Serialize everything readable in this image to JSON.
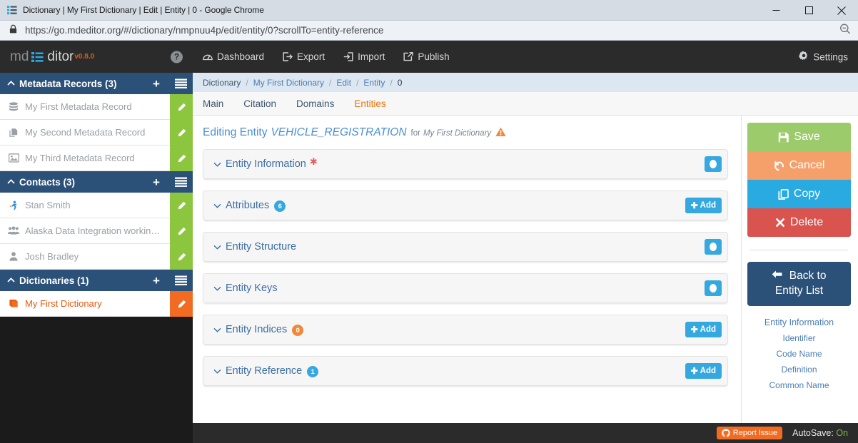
{
  "browser": {
    "tab_title": "Dictionary | My First Dictionary | Edit | Entity | 0 - Google Chrome",
    "favicon_name": "mdeditor-list-icon",
    "url": "https://go.mdeditor.org/#/dictionary/nmpnuu4p/edit/entity/0?scrollTo=entity-reference",
    "url_scheme": "https://",
    "url_domain": "go.mdeditor.org",
    "url_path": "/#/dictionary/nmpnuu4p/edit/entity/0?scrollTo=entity-reference",
    "lock_icon": "lock-icon",
    "zoom_icon": "zoom-out-icon",
    "minimize_label": "Minimize",
    "maximize_label": "Maximize",
    "close_label": "Close"
  },
  "brand": {
    "prefix": "md",
    "suffix": "ditor",
    "version": "v0.8.0",
    "help_label": "?",
    "logo_icon": "list-blue-icon"
  },
  "sidebar": {
    "groups": [
      {
        "title": "Metadata Records (3)",
        "caret": "⌃",
        "add_label": "+",
        "menu_icon": "list-menu-icon",
        "items": [
          {
            "label": "My First Metadata Record",
            "icon": "database-icon",
            "active": false
          },
          {
            "label": "My Second Metadata Record",
            "icon": "copy-files-icon",
            "active": false
          },
          {
            "label": "My Third Metadata Record",
            "icon": "image-icon",
            "active": false
          }
        ]
      },
      {
        "title": "Contacts (3)",
        "caret": "⌃",
        "add_label": "+",
        "menu_icon": "list-menu-icon",
        "items": [
          {
            "label": "Stan Smith",
            "icon": "runner-person-icon",
            "active": false
          },
          {
            "label": "Alaska Data Integration working…",
            "icon": "group-people-icon",
            "active": false
          },
          {
            "label": "Josh Bradley",
            "icon": "person-icon",
            "active": false
          }
        ]
      },
      {
        "title": "Dictionaries (1)",
        "caret": "⌃",
        "add_label": "+",
        "menu_icon": "list-menu-icon",
        "items": [
          {
            "label": "My First Dictionary",
            "icon": "book-icon",
            "active": true
          }
        ]
      }
    ]
  },
  "topnav": {
    "items": [
      {
        "label": "Dashboard",
        "icon": "dashboard-icon"
      },
      {
        "label": "Export",
        "icon": "export-icon"
      },
      {
        "label": "Import",
        "icon": "import-icon"
      },
      {
        "label": "Publish",
        "icon": "publish-icon"
      }
    ],
    "settings_label": "Settings",
    "settings_icon": "gear-icon"
  },
  "breadcrumb": {
    "items": [
      "Dictionary",
      "My First Dictionary",
      "Edit",
      "Entity",
      "0"
    ],
    "separator": "/"
  },
  "tabs": [
    {
      "label": "Main",
      "active": false
    },
    {
      "label": "Citation",
      "active": false
    },
    {
      "label": "Domains",
      "active": false
    },
    {
      "label": "Entities",
      "active": true
    }
  ],
  "editing": {
    "prefix": "Editing Entity",
    "entity": "VEHICLE_REGISTRATION",
    "for_word": "for",
    "dictionary": "My First Dictionary",
    "warning_icon": "warning-triangle-icon"
  },
  "panels": [
    {
      "title": "Entity Information",
      "required": true,
      "badge": null,
      "badge_color": null,
      "action": "circle",
      "action_label": ""
    },
    {
      "title": "Attributes",
      "required": false,
      "badge": "6",
      "badge_color": "#36a8e0",
      "action": "add",
      "action_label": "Add"
    },
    {
      "title": "Entity Structure",
      "required": false,
      "badge": null,
      "badge_color": null,
      "action": "circle",
      "action_label": ""
    },
    {
      "title": "Entity Keys",
      "required": false,
      "badge": null,
      "badge_color": null,
      "action": "circle",
      "action_label": ""
    },
    {
      "title": "Entity Indices",
      "required": false,
      "badge": "0",
      "badge_color": "#f0883a",
      "action": "add",
      "action_label": "Add"
    },
    {
      "title": "Entity Reference",
      "required": false,
      "badge": "1",
      "badge_color": "#36a8e0",
      "action": "add",
      "action_label": "Add"
    }
  ],
  "rail": {
    "actions": [
      {
        "label": "Save",
        "icon": "floppy-disk-icon",
        "color": "#9ccb6b"
      },
      {
        "label": "Cancel",
        "icon": "undo-arrow-icon",
        "color": "#f5a06a"
      },
      {
        "label": "Copy",
        "icon": "copy-icon",
        "color": "#29abe2"
      },
      {
        "label": "Delete",
        "icon": "x-mark-icon",
        "color": "#d9534f"
      }
    ],
    "back_line1": "Back to",
    "back_line2": "Entity List",
    "back_icon": "arrow-left-icon",
    "nav_header": "Entity Information",
    "nav_items": [
      "Identifier",
      "Code Name",
      "Definition",
      "Common Name"
    ]
  },
  "footer": {
    "report_label": "Report Issue",
    "report_icon": "github-icon",
    "autosave_label": "AutoSave:",
    "autosave_value": "On"
  },
  "colors": {
    "accent_blue": "#36a8e0",
    "accent_orange": "#e8590c",
    "nav_dark": "#2b2b2b",
    "group_blue": "#2c5179",
    "green": "#8cc63e"
  }
}
